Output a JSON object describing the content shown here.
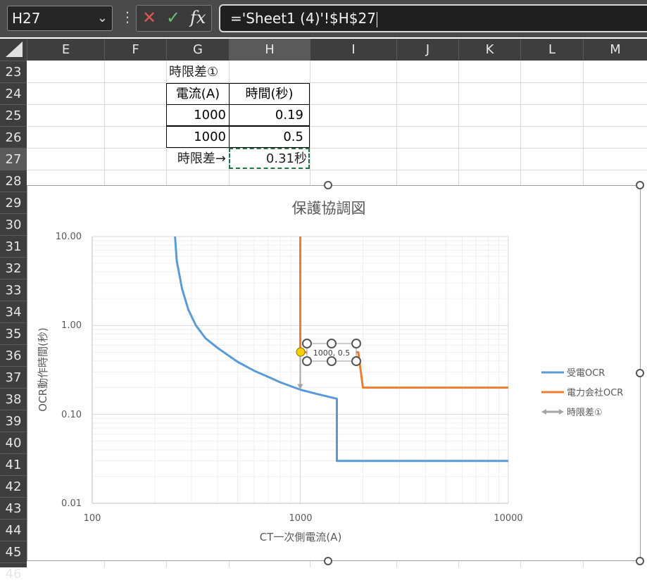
{
  "formula_bar": {
    "name_box": "H27",
    "cancel_icon": "x-icon",
    "enter_icon": "check-icon",
    "function_icon": "fx-icon",
    "formula": "='Sheet1 (4)'!$H$27"
  },
  "columns": [
    "E",
    "F",
    "G",
    "H",
    "I",
    "J",
    "K",
    "L",
    "M"
  ],
  "rows": [
    "23",
    "24",
    "25",
    "26",
    "27",
    "28",
    "29",
    "30",
    "31",
    "32",
    "33",
    "34",
    "35",
    "36",
    "37",
    "38",
    "39",
    "40",
    "41",
    "42",
    "43",
    "44",
    "45",
    "46"
  ],
  "cells": {
    "g23": "時限差①",
    "g24": "電流(A)",
    "h24": "時間(秒)",
    "g25": "1000",
    "h25": "0.19",
    "g26": "1000",
    "h26": "0.5",
    "g27": "時限差→",
    "h27": "0.31秒"
  },
  "selected_cell": "H27",
  "chart_data": {
    "type": "line",
    "title": "保護協調図",
    "xlabel": "CT一次側電流(A)",
    "ylabel": "OCR動作時間(秒)",
    "x_scale": "log",
    "y_scale": "log",
    "xlim": [
      100,
      10000
    ],
    "ylim": [
      0.01,
      10
    ],
    "x_ticks": [
      "100",
      "1000",
      "10000"
    ],
    "y_ticks": [
      "10.00",
      "1.00",
      "0.10",
      "0.01"
    ],
    "grid": true,
    "legend_position": "right",
    "series": [
      {
        "name": "受電OCR",
        "color": "#5b9bd5",
        "points": [
          [
            250,
            10
          ],
          [
            255,
            5.3
          ],
          [
            270,
            2.6
          ],
          [
            290,
            1.5
          ],
          [
            315,
            1.0
          ],
          [
            350,
            0.72
          ],
          [
            400,
            0.56
          ],
          [
            500,
            0.39
          ],
          [
            600,
            0.31
          ],
          [
            700,
            0.265
          ],
          [
            800,
            0.23
          ],
          [
            1000,
            0.19
          ],
          [
            1200,
            0.17
          ],
          [
            1500,
            0.15
          ],
          [
            1500,
            0.03
          ],
          [
            10000,
            0.03
          ]
        ]
      },
      {
        "name": "電力会社OCR",
        "color": "#ed7d31",
        "points": [
          [
            1000,
            10
          ],
          [
            1000,
            0.5
          ],
          [
            1900,
            0.5
          ],
          [
            2000,
            0.2
          ],
          [
            10000,
            0.2
          ]
        ]
      },
      {
        "name": "時限差①",
        "color": "#a5a5a5",
        "points": [
          [
            1000,
            0.5
          ],
          [
            1000,
            0.19
          ]
        ]
      }
    ],
    "data_label": "1000, 0.5"
  }
}
